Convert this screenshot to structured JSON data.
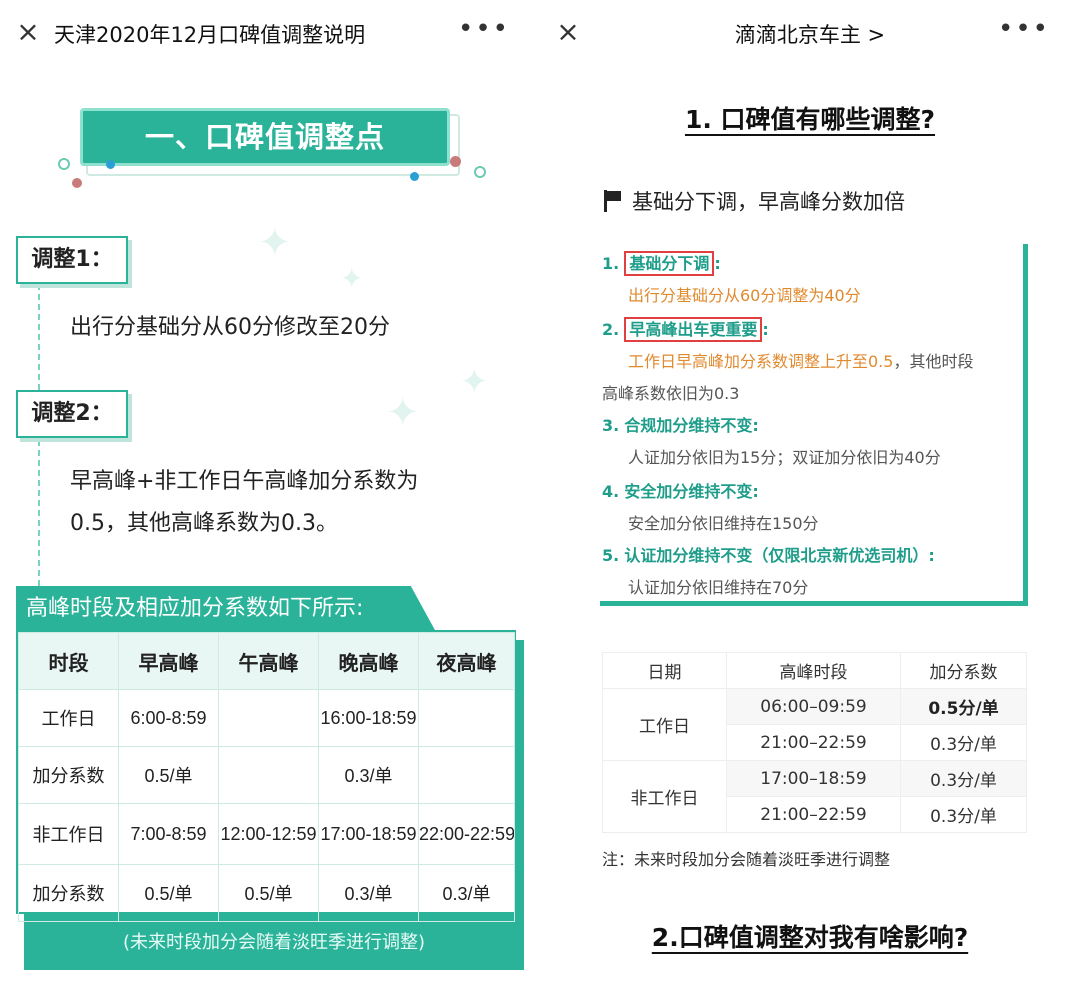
{
  "left": {
    "nav_title": "天津2020年12月口碑值调整说明",
    "close_glyph": "×",
    "more_glyph": "•••",
    "section_title": "一、口碑值调整点",
    "adjustments": [
      {
        "tag": "调整1：",
        "text_lines": [
          "出行分基础分从60分修改至20分"
        ]
      },
      {
        "tag": "调整2：",
        "text_lines": [
          "早高峰+非工作日午高峰加分系数为",
          " 0.5，其他高峰系数为0.3。"
        ]
      }
    ],
    "table_title": "高峰时段及相应加分系数如下所示:",
    "table_headers": [
      "时段",
      "早高峰",
      "午高峰",
      "晚高峰",
      "夜高峰"
    ],
    "table_rows": [
      [
        "工作日",
        "6:00-8:59",
        "",
        "16:00-18:59",
        ""
      ],
      [
        "加分系数",
        "0.5/单",
        "",
        "0.3/单",
        ""
      ],
      [
        "非工作日",
        "7:00-8:59",
        "12:00-12:59",
        "17:00-18:59",
        "22:00-22:59"
      ],
      [
        "加分系数",
        "0.5/单",
        "0.5/单",
        "0.3/单",
        "0.3/单"
      ]
    ],
    "table_note": "(未来时段加分会随着淡旺季进行调整)"
  },
  "right": {
    "nav_title": "滴滴北京车主 >",
    "close_glyph": "×",
    "more_glyph": "•••",
    "heading1": "1. 口碑值有哪些调整?",
    "flag_text": "基础分下调，早高峰分数加倍",
    "items": [
      {
        "num": "1.",
        "title": "基础分下调",
        "suffix": ":",
        "lines": [
          "出行分基础分从60分调整为40分"
        ]
      },
      {
        "num": "2.",
        "title": "早高峰出车更重要",
        "suffix": ":",
        "line_a_orange": "工作日早高峰加分系数调整上升至0.5",
        "line_a_gray": "，其他时段",
        "line_b": "高峰系数依旧为0.3"
      },
      {
        "num": "3.",
        "title": "合规加分维持不变:",
        "lines": [
          "人证加分依旧为15分；双证加分依旧为40分"
        ]
      },
      {
        "num": "4.",
        "title": "安全加分维持不变:",
        "lines": [
          "安全加分依旧维持在150分"
        ]
      },
      {
        "num": "5.",
        "title": "认证加分维持不变（仅限北京新优选司机）",
        "suffix": ":",
        "lines": [
          "认证加分依旧维持在70分"
        ]
      }
    ],
    "table_headers": [
      "日期",
      "高峰时段",
      "加分系数"
    ],
    "table_groups": [
      {
        "date": "工作日",
        "rows": [
          [
            "06:00–09:59",
            "0.5分/单"
          ],
          [
            "21:00–22:59",
            "0.3分/单"
          ]
        ]
      },
      {
        "date": "非工作日",
        "rows": [
          [
            "17:00–18:59",
            "0.3分/单"
          ],
          [
            "21:00–22:59",
            "0.3分/单"
          ]
        ]
      }
    ],
    "note": "注：未来时段加分会随着淡旺季进行调整",
    "heading2": "2.口碑值调整对我有啥影响?"
  },
  "colors": {
    "teal": "#2bb39a",
    "orange": "#e08a2e",
    "red": "#e04040"
  }
}
